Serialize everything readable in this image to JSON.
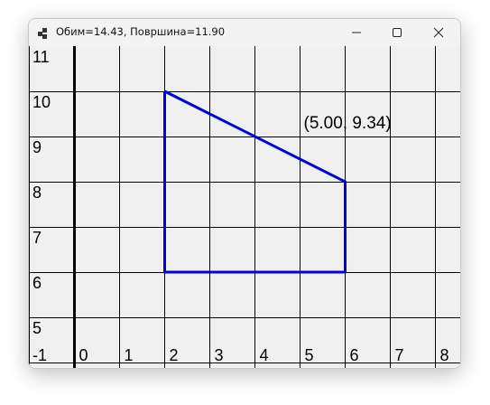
{
  "window": {
    "title": "Обим=14.43, Површина=11.90",
    "icon": "app-window-icon",
    "controls": {
      "minimize_icon": "minimize-icon",
      "maximize_icon": "maximize-icon",
      "close_icon": "close-icon"
    }
  },
  "chart_data": {
    "type": "line",
    "title": "",
    "xlabel": "",
    "ylabel": "",
    "xlim": [
      -1,
      8
    ],
    "ylim": [
      5,
      11
    ],
    "grid": true,
    "x_ticks": [
      "-1",
      "0",
      "1",
      "2",
      "3",
      "4",
      "5",
      "6",
      "7",
      "8"
    ],
    "y_ticks": [
      "5",
      "6",
      "7",
      "8",
      "9",
      "10",
      "11"
    ],
    "series": [
      {
        "color": "#0000dd",
        "points": [
          {
            "x": 2,
            "y": 10
          },
          {
            "x": 6,
            "y": 8
          },
          {
            "x": 6,
            "y": 7
          },
          {
            "x": 6,
            "y": 6
          },
          {
            "x": 3,
            "y": 6
          },
          {
            "x": 2,
            "y": 6
          },
          {
            "x": 2,
            "y": 8
          },
          {
            "x": 2,
            "y": 10
          }
        ]
      }
    ],
    "annotation": {
      "x": 5,
      "y": 9.34,
      "text": "(5.00, 9.34)"
    },
    "colors": {
      "grid": "#000000",
      "axis": "#000000",
      "polygon": "#0000dd",
      "background": "#f0f0f0"
    }
  }
}
